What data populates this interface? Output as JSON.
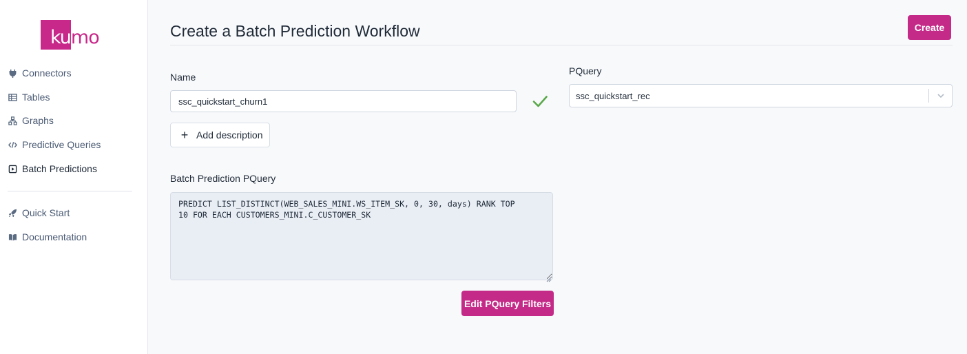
{
  "brand": {
    "logo_text": "kumo",
    "color": "#c8288a"
  },
  "sidebar": {
    "items": [
      {
        "label": "Connectors",
        "icon": "plug-icon"
      },
      {
        "label": "Tables",
        "icon": "table-icon"
      },
      {
        "label": "Graphs",
        "icon": "graph-icon"
      },
      {
        "label": "Predictive Queries",
        "icon": "code-icon"
      },
      {
        "label": "Batch Predictions",
        "icon": "play-square-icon",
        "active": true
      }
    ],
    "secondary_items": [
      {
        "label": "Quick Start",
        "icon": "rocket-icon"
      },
      {
        "label": "Documentation",
        "icon": "book-icon"
      }
    ]
  },
  "page": {
    "title": "Create a Batch Prediction Workflow",
    "create_label": "Create"
  },
  "form": {
    "name_label": "Name",
    "name_value": "ssc_quickstart_churn1",
    "add_description_label": "Add description",
    "batch_query_label": "Batch Prediction PQuery",
    "batch_query_text": "PREDICT LIST_DISTINCT(WEB_SALES_MINI.WS_ITEM_SK, 0, 30, days) RANK TOP\n10 FOR EACH CUSTOMERS_MINI.C_CUSTOMER_SK",
    "edit_filters_label": "Edit PQuery Filters",
    "pquery_label": "PQuery",
    "pquery_selected": "ssc_quickstart_rec"
  },
  "colors": {
    "accent": "#c42a87",
    "valid": "#5aa84a"
  }
}
